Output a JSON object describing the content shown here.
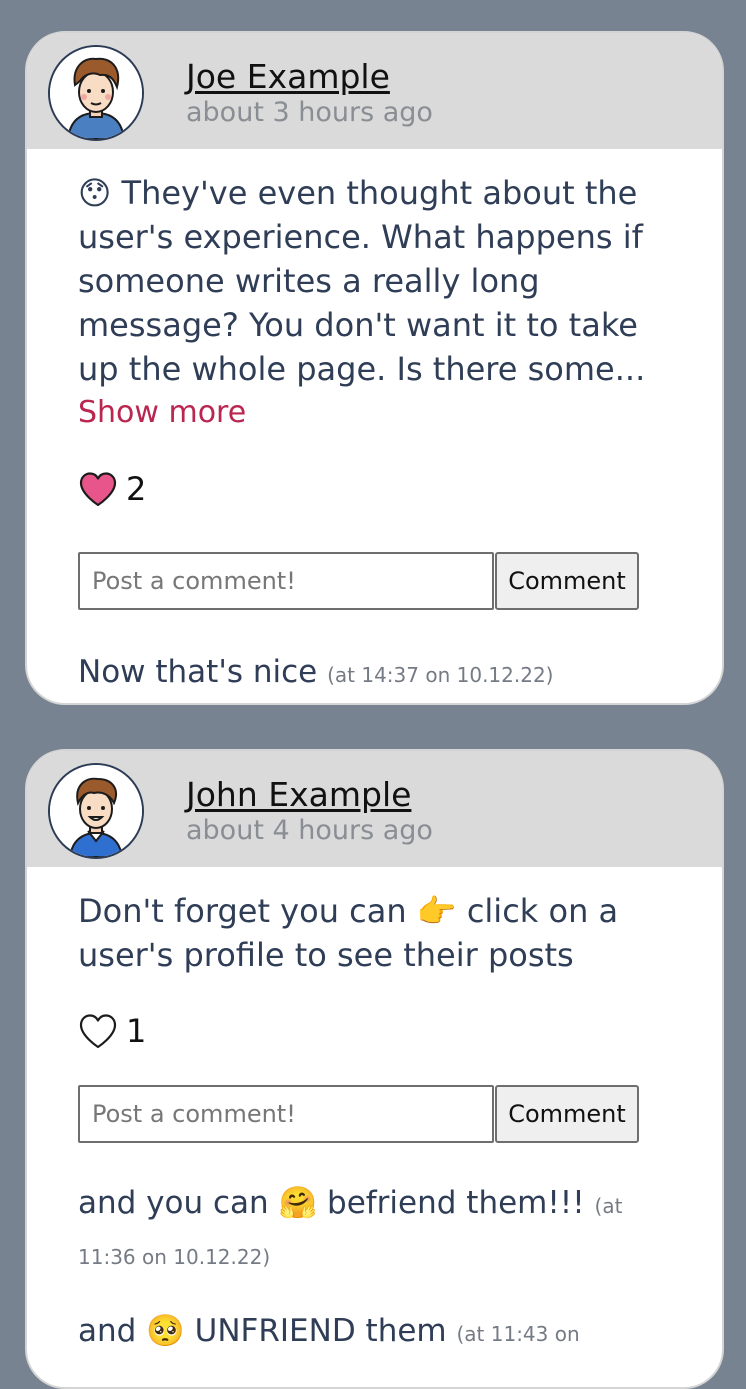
{
  "posts": [
    {
      "author": "Joe Example",
      "time": "about 3 hours ago",
      "emoji": "😯",
      "message": "They've even thought about the user's experience. What happens if someone writes a really long message? You don't want it to take up the whole page. Is there some...",
      "show_more": "Show more",
      "liked": true,
      "likes": "2",
      "comment_placeholder": "Post a comment!",
      "comment_button": "Comment",
      "comments": [
        {
          "text": "Now that's nice",
          "stamp": "(at 14:37 on 10.12.22)"
        }
      ]
    },
    {
      "author": "John Example",
      "time": "about 4 hours ago",
      "message_before": "Don't forget you can",
      "emoji": "👉",
      "message_after": "click on a user's profile to see their posts",
      "liked": false,
      "likes": "1",
      "comment_placeholder": "Post a comment!",
      "comment_button": "Comment",
      "comments": [
        {
          "before": "and you can",
          "emoji": "🤗",
          "after": "befriend them!!!",
          "stamp": "(at 11:36 on 10.12.22)"
        },
        {
          "before": "and",
          "emoji": "🥺",
          "after": "UNFRIEND them",
          "stamp": "(at 11:43 on"
        }
      ]
    }
  ],
  "colors": {
    "page_bg": "#778390",
    "header_bg": "#dadada",
    "link_accent": "#b9264f",
    "heart_fill": "#e8558a"
  },
  "icons": {
    "liked_heart": "heart-filled-icon",
    "unliked_heart": "heart-outline-icon"
  }
}
